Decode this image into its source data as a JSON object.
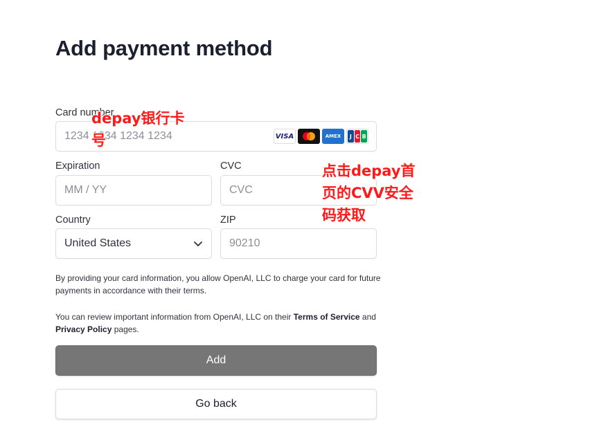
{
  "page": {
    "title": "Add payment method"
  },
  "card_number": {
    "label": "Card number",
    "placeholder": "1234 1234 1234 1234",
    "brands": [
      {
        "name": "visa",
        "text": "VISA"
      },
      {
        "name": "mastercard",
        "text": ""
      },
      {
        "name": "amex",
        "text": "AMEX"
      },
      {
        "name": "jcb",
        "text": "JCB"
      }
    ]
  },
  "expiration": {
    "label": "Expiration",
    "placeholder": "MM / YY"
  },
  "cvc": {
    "label": "CVC",
    "placeholder": "CVC"
  },
  "country": {
    "label": "Country",
    "value": "United States"
  },
  "zip": {
    "label": "ZIP",
    "placeholder": "90210"
  },
  "legal": {
    "line1": "By providing your card information, you allow OpenAI, LLC to charge your card for future payments in accordance with their terms.",
    "line2_pre": "You can review important information from OpenAI, LLC on their ",
    "terms_link": "Terms of Service",
    "line2_mid": " and ",
    "privacy_link": "Privacy Policy",
    "line2_post": " pages."
  },
  "buttons": {
    "add": "Add",
    "back": "Go back"
  },
  "annotations": {
    "card_note_line1": "depay银行卡",
    "card_note_line2": "号",
    "cvv_note_line1": "点击depay首",
    "cvv_note_line2": "页的CVV安全",
    "cvv_note_line3": "码获取",
    "color": "#ff1a1a"
  }
}
